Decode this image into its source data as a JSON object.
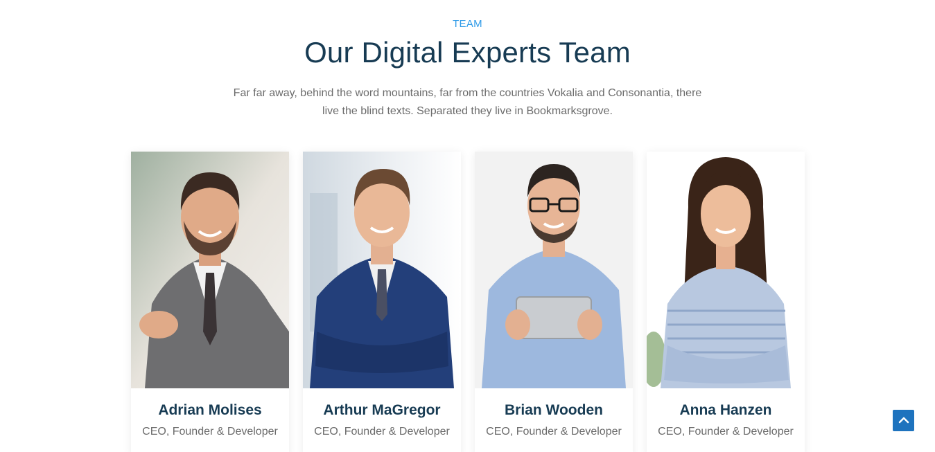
{
  "section": {
    "eyebrow": "TEAM",
    "heading": "Our Digital Experts Team",
    "intro": "Far far away, behind the word mountains, far from the countries Vokalia and Consonantia, there live the blind texts. Separated they live in Bookmarksgrove."
  },
  "members": [
    {
      "name": "Adrian Molises",
      "role": "CEO, Founder & Developer"
    },
    {
      "name": "Arthur MaGregor",
      "role": "CEO, Founder & Developer"
    },
    {
      "name": "Brian Wooden",
      "role": "CEO, Founder & Developer"
    },
    {
      "name": "Anna Hanzen",
      "role": "CEO, Founder & Developer"
    }
  ],
  "scroll_top": {
    "icon": "arrow-up-icon",
    "color": "#1e73be"
  },
  "colors": {
    "accent": "#2f9be8",
    "heading": "#173b53",
    "body_text": "#6b6b6b"
  }
}
